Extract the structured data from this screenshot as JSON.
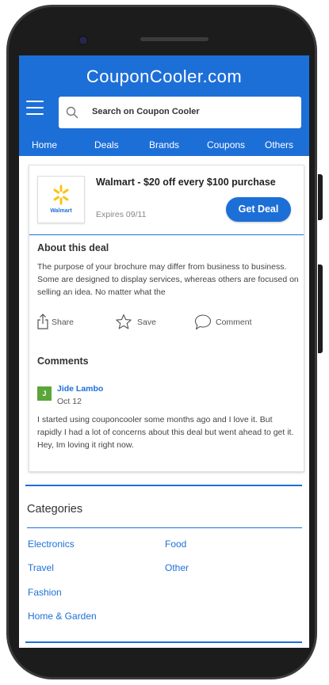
{
  "header": {
    "brand": "CouponCooler.com",
    "search_placeholder": "Search on Coupon Cooler",
    "nav": [
      "Home",
      "Deals",
      "Brands",
      "Coupons",
      "Others"
    ]
  },
  "deal": {
    "store_logo_text": "Walmart",
    "title": "Walmart - $20 off every $100 purchase",
    "expires": "Expires 09/11",
    "cta": "Get Deal"
  },
  "about": {
    "heading": "About this deal",
    "body": "The purpose of your brochure may differ from business to business. Some are designed to display services, whereas others are focused on selling an idea. No matter what the"
  },
  "actions": {
    "share": "Share",
    "save": "Save",
    "comment": "Comment"
  },
  "comments": {
    "heading": "Comments",
    "items": [
      {
        "initial": "J",
        "author": "Jide Lambo",
        "date": "Oct 12",
        "text": "I started using couponcooler some months ago and I love it. But rapidly I had a lot of concerns about this deal but went ahead to get it. Hey, Im loving it right now."
      }
    ]
  },
  "categories": {
    "heading": "Categories",
    "items": [
      "Electronics",
      "Food",
      "Travel",
      "Other",
      "Fashion",
      "Home & Garden"
    ]
  },
  "colors": {
    "accent": "#1d6fd8",
    "walmart_spark": "#f9c314",
    "avatar": "#5aa63a"
  }
}
